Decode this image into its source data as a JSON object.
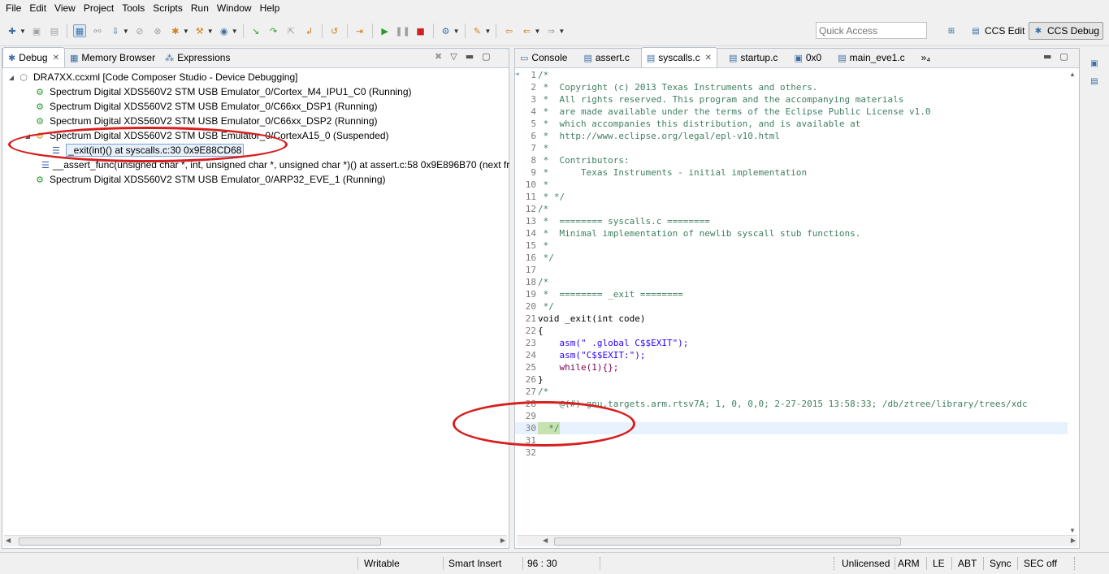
{
  "menu": [
    "File",
    "Edit",
    "View",
    "Project",
    "Tools",
    "Scripts",
    "Run",
    "Window",
    "Help"
  ],
  "toolbar": {
    "quick_access_placeholder": "Quick Access",
    "perspectives": [
      {
        "label": "CCS Edit",
        "active": false
      },
      {
        "label": "CCS Debug",
        "active": true
      }
    ]
  },
  "debug_view": {
    "tabs": [
      {
        "label": "Debug",
        "icon": "debug-icon",
        "active": true
      },
      {
        "label": "Memory Browser",
        "icon": "memory-icon",
        "active": false
      },
      {
        "label": "Expressions",
        "icon": "expressions-icon",
        "active": false
      }
    ],
    "tree": [
      {
        "level": 0,
        "kind": "config",
        "label": "DRA7XX.ccxml [Code Composer Studio - Device Debugging]",
        "expanded": true
      },
      {
        "level": 1,
        "kind": "running",
        "label": "Spectrum Digital XDS560V2 STM USB Emulator_0/Cortex_M4_IPU1_C0 (Running)"
      },
      {
        "level": 1,
        "kind": "running",
        "label": "Spectrum Digital XDS560V2 STM USB Emulator_0/C66xx_DSP1 (Running)"
      },
      {
        "level": 1,
        "kind": "running",
        "label": "Spectrum Digital XDS560V2 STM USB Emulator_0/C66xx_DSP2 (Running)"
      },
      {
        "level": 1,
        "kind": "suspended",
        "label": "Spectrum Digital XDS560V2 STM USB Emulator_0/CortexA15_0 (Suspended)",
        "expanded": true
      },
      {
        "level": 2,
        "kind": "frame",
        "label": "_exit(int)() at syscalls.c:30 0x9E88CD68",
        "selected": true
      },
      {
        "level": 2,
        "kind": "frame",
        "label": "__assert_func(unsigned char *, int, unsigned char *, unsigned char *)() at assert.c:58 0x9E896B70  (next fr"
      },
      {
        "level": 1,
        "kind": "running",
        "label": "Spectrum Digital XDS560V2 STM USB Emulator_0/ARP32_EVE_1 (Running)"
      }
    ]
  },
  "editor": {
    "tabs": [
      {
        "label": "Console",
        "icon": "console-icon",
        "active": false
      },
      {
        "label": "assert.c",
        "icon": "c-file-icon",
        "active": false
      },
      {
        "label": "syscalls.c",
        "icon": "c-file-icon",
        "active": true
      },
      {
        "label": "startup.c",
        "icon": "c-file-icon",
        "active": false
      },
      {
        "label": "0x0",
        "icon": "disassembly-icon",
        "active": false
      },
      {
        "label": "main_eve1.c",
        "icon": "c-file-icon",
        "active": false
      },
      {
        "label": "»₄",
        "icon": "",
        "active": false
      }
    ],
    "current_line": 30,
    "lines": [
      {
        "n": "1",
        "t": "/*",
        "c": "com"
      },
      {
        "n": "2",
        "t": " *  Copyright (c) 2013 Texas Instruments and others.",
        "c": "com"
      },
      {
        "n": "3",
        "t": " *  All rights reserved. This program and the accompanying materials",
        "c": "com"
      },
      {
        "n": "4",
        "t": " *  are made available under the terms of the Eclipse Public License v1.0",
        "c": "com"
      },
      {
        "n": "5",
        "t": " *  which accompanies this distribution, and is available at",
        "c": "com"
      },
      {
        "n": "6",
        "t": " *  http://www.eclipse.org/legal/epl-v10.html",
        "c": "com"
      },
      {
        "n": "7",
        "t": " *",
        "c": "com"
      },
      {
        "n": "8",
        "t": " *  Contributors:",
        "c": "com"
      },
      {
        "n": "9",
        "t": " *      Texas Instruments - initial implementation",
        "c": "com"
      },
      {
        "n": "10",
        "t": " *",
        "c": "com"
      },
      {
        "n": "11",
        "t": " * */",
        "c": "com"
      },
      {
        "n": "12",
        "t": "/*",
        "c": "com"
      },
      {
        "n": "13",
        "t": " *  ======== syscalls.c ========",
        "c": "com"
      },
      {
        "n": "14",
        "t": " *  Minimal implementation of newlib syscall stub functions.",
        "c": "com"
      },
      {
        "n": "15",
        "t": " *",
        "c": "com"
      },
      {
        "n": "16",
        "t": " */",
        "c": "com"
      },
      {
        "n": "17",
        "t": "",
        "c": "plain"
      },
      {
        "n": "18",
        "t": "/*",
        "c": "com"
      },
      {
        "n": "19",
        "t": " *  ======== _exit ========",
        "c": "com"
      },
      {
        "n": "20",
        "t": " */",
        "c": "com"
      },
      {
        "n": "21",
        "t": "void _exit(int code)",
        "c": "decl"
      },
      {
        "n": "22",
        "t": "{",
        "c": "plain"
      },
      {
        "n": "23",
        "t": "    asm(\" .global C$$EXIT\");",
        "c": "asm"
      },
      {
        "n": "24",
        "t": "    asm(\"C$$EXIT:\");",
        "c": "asm"
      },
      {
        "n": "25",
        "t": "    while(1){};",
        "c": "while"
      },
      {
        "n": "26",
        "t": "}",
        "c": "plain"
      },
      {
        "n": "27",
        "t": "/*",
        "c": "com"
      },
      {
        "n": "28",
        "t": "    @(#) gnu.targets.arm.rtsv7A; 1, 0, 0,0; 2-27-2015 13:58:33; /db/ztree/library/trees/xdc",
        "c": "com"
      },
      {
        "n": "29",
        "t": "",
        "c": "plain"
      },
      {
        "n": "30",
        "t": "  */",
        "c": "cur"
      },
      {
        "n": "31",
        "t": "",
        "c": "plain"
      },
      {
        "n": "32",
        "t": "",
        "c": "plain"
      }
    ]
  },
  "statusbar": {
    "writable": "Writable",
    "insert_mode": "Smart Insert",
    "position": "96 : 30",
    "license": "Unlicensed",
    "arch": "ARM",
    "endian": "LE",
    "abi": "ABT",
    "sync": "Sync",
    "sec": "SEC off"
  },
  "colors": {
    "annotation": "#d81e1e",
    "comment": "#3f7f5f",
    "keyword": "#7f0055",
    "string": "#2a00ff",
    "current_line": "#e8f2fe"
  }
}
